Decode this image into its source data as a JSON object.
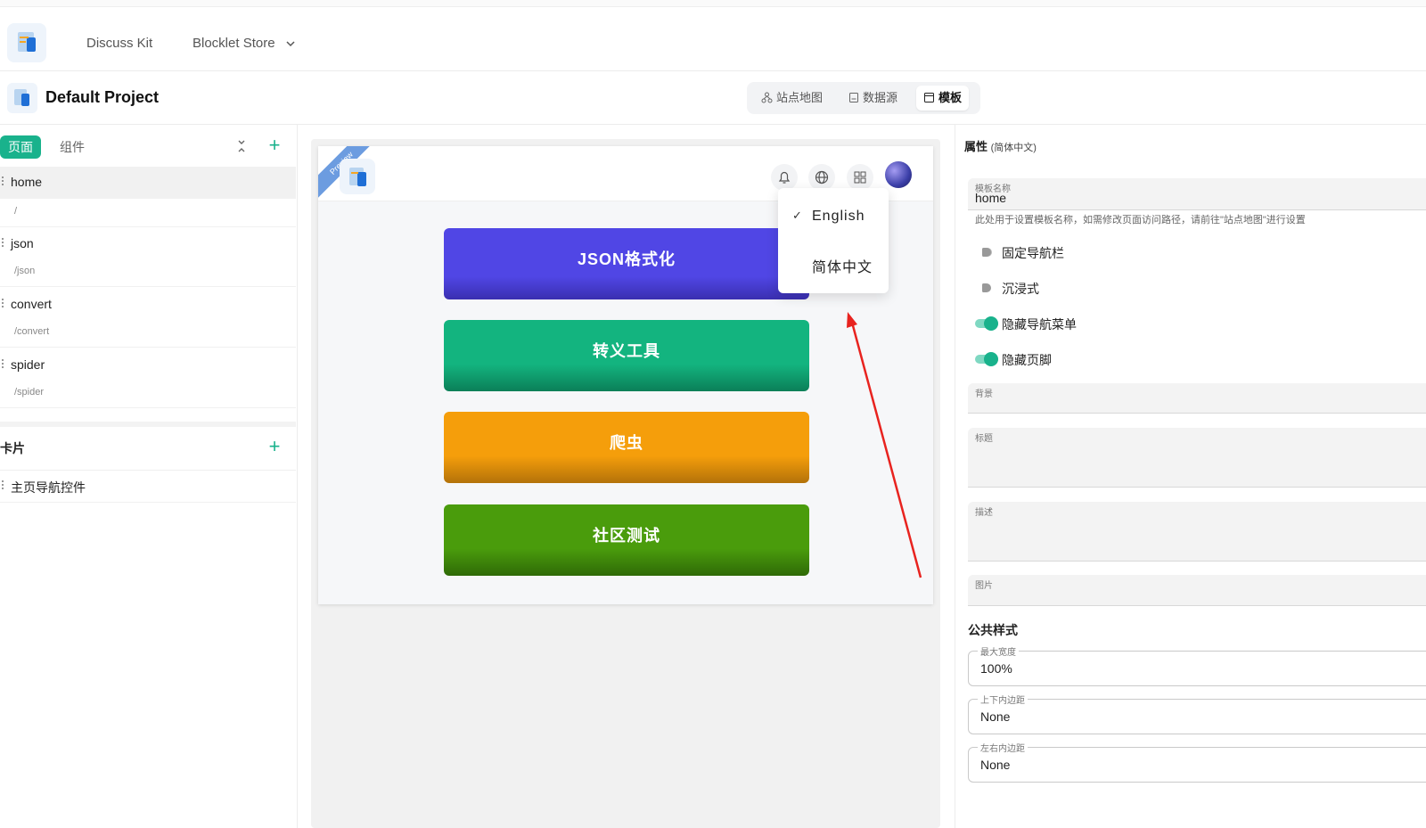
{
  "topnav": {
    "links": [
      "Discuss Kit",
      "Blocklet Store"
    ]
  },
  "project": {
    "title": "Default Project"
  },
  "segments": [
    "站点地图",
    "数据源",
    "模板"
  ],
  "left": {
    "tabs": [
      "页面",
      "组件"
    ],
    "pages": [
      {
        "name": "home",
        "path": "/"
      },
      {
        "name": "json",
        "path": "/json"
      },
      {
        "name": "convert",
        "path": "/convert"
      },
      {
        "name": "spider",
        "path": "/spider"
      }
    ],
    "cards_header": "卡片",
    "cards": [
      "主页导航控件"
    ]
  },
  "preview": {
    "ribbon": "Preview",
    "buttons": [
      {
        "label": "JSON格式化",
        "color": "#5046e5"
      },
      {
        "label": "转义工具",
        "color": "#13b47f"
      },
      {
        "label": "爬虫",
        "color": "#f59e0b"
      },
      {
        "label": "社区测试",
        "color": "#4a9c0c"
      }
    ],
    "dropdown": [
      "English",
      "简体中文"
    ],
    "dropdown_check": "✓"
  },
  "right": {
    "title": "属性",
    "title_lang": "(简体中文)",
    "template_name_label": "模板名称",
    "template_name_value": "home",
    "hint": "此处用于设置模板名称，如需修改页面访问路径，请前往\"站点地图\"进行设置",
    "toggles": [
      {
        "label": "固定导航栏",
        "on": false
      },
      {
        "label": "沉浸式",
        "on": false
      },
      {
        "label": "隐藏导航菜单",
        "on": true
      },
      {
        "label": "隐藏页脚",
        "on": true
      }
    ],
    "bg_label": "背景",
    "title_label": "标题",
    "desc_label": "描述",
    "image_label": "图片",
    "public_style": "公共样式",
    "max_width_label": "最大宽度",
    "max_width_value": "100%",
    "vpad_label": "上下内边距",
    "vpad_value": "None",
    "hpad_label": "左右内边距",
    "hpad_value": "None",
    "accent": "#19b28c"
  }
}
